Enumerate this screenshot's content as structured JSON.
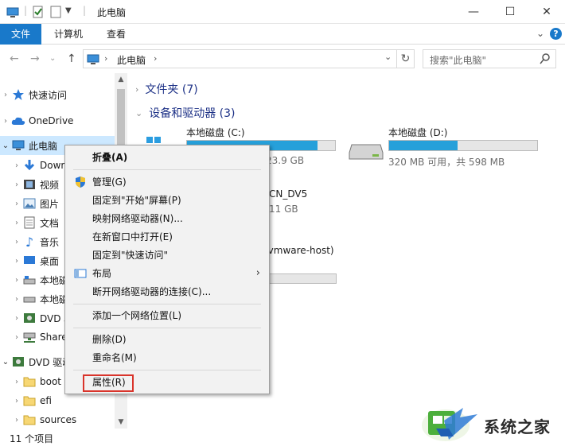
{
  "window": {
    "title": "此电脑",
    "controls": {
      "minimize": "—",
      "maximize": "☐",
      "close": "✕"
    }
  },
  "ribbon": {
    "tabs": [
      "文件",
      "计算机",
      "查看"
    ],
    "help": "?"
  },
  "address": {
    "crumb": "此电脑",
    "separator": "›",
    "dropdown": "⌄",
    "search_placeholder": "搜索\"此电脑\""
  },
  "nav": {
    "items": [
      {
        "label": "快速访问",
        "icon": "star-icon"
      },
      {
        "label": "OneDrive",
        "icon": "cloud-icon"
      },
      {
        "label": "此电脑",
        "icon": "computer-icon"
      },
      {
        "label": "Downloads",
        "icon": "download-icon"
      },
      {
        "label": "视频",
        "icon": "video-icon"
      },
      {
        "label": "图片",
        "icon": "picture-icon"
      },
      {
        "label": "文档",
        "icon": "document-icon"
      },
      {
        "label": "音乐",
        "icon": "music-icon"
      },
      {
        "label": "桌面",
        "icon": "desktop-icon"
      },
      {
        "label": "本地磁盘 (C:)",
        "icon": "drive-c-icon"
      },
      {
        "label": "本地磁盘 (D:)",
        "icon": "drive-d-icon"
      },
      {
        "label": "DVD 驱动器",
        "icon": "dvd-icon"
      },
      {
        "label": "Shared Folders",
        "icon": "network-drive-icon"
      },
      {
        "label": "DVD 驱动器",
        "icon": "dvd-icon"
      },
      {
        "label": "boot",
        "icon": "folder-icon"
      },
      {
        "label": "efi",
        "icon": "folder-icon"
      },
      {
        "label": "sources",
        "icon": "folder-icon"
      }
    ]
  },
  "main": {
    "folders_header": "文件夹 (7)",
    "devices_header": "设备和驱动器 (3)",
    "drives": [
      {
        "name": "本地磁盘 (C:)",
        "info": "23.9 GB",
        "used_fraction": 0.88
      },
      {
        "name": "本地磁盘 (D:)",
        "info": "320 MB 可用，共 598 MB",
        "used_fraction": 0.46
      },
      {
        "name": "CN_DV5",
        "info": "11 GB"
      },
      {
        "name": "(vmware-host)",
        "used_fraction": 0.0
      }
    ]
  },
  "status": {
    "item_count": "11 个项目"
  },
  "context_menu": {
    "items": [
      {
        "label": "折叠(A)",
        "bold": true
      },
      {
        "label": "管理(G)",
        "icon": "shield-icon"
      },
      {
        "label": "固定到\"开始\"屏幕(P)"
      },
      {
        "label": "映射网络驱动器(N)..."
      },
      {
        "label": "在新窗口中打开(E)"
      },
      {
        "label": "固定到\"快速访问\""
      },
      {
        "label": "布局",
        "icon": "layout-icon",
        "submenu": "›"
      },
      {
        "label": "断开网络驱动器的连接(C)..."
      },
      {
        "label": "添加一个网络位置(L)"
      },
      {
        "label": "删除(D)"
      },
      {
        "label": "重命名(M)"
      },
      {
        "label": "属性(R)"
      }
    ]
  },
  "watermark": {
    "text": "系统之家"
  },
  "colors": {
    "accent": "#1979ca",
    "selection": "#cce8ff",
    "highlight_box": "#d9342b",
    "drive_fill": "#26a0da"
  }
}
